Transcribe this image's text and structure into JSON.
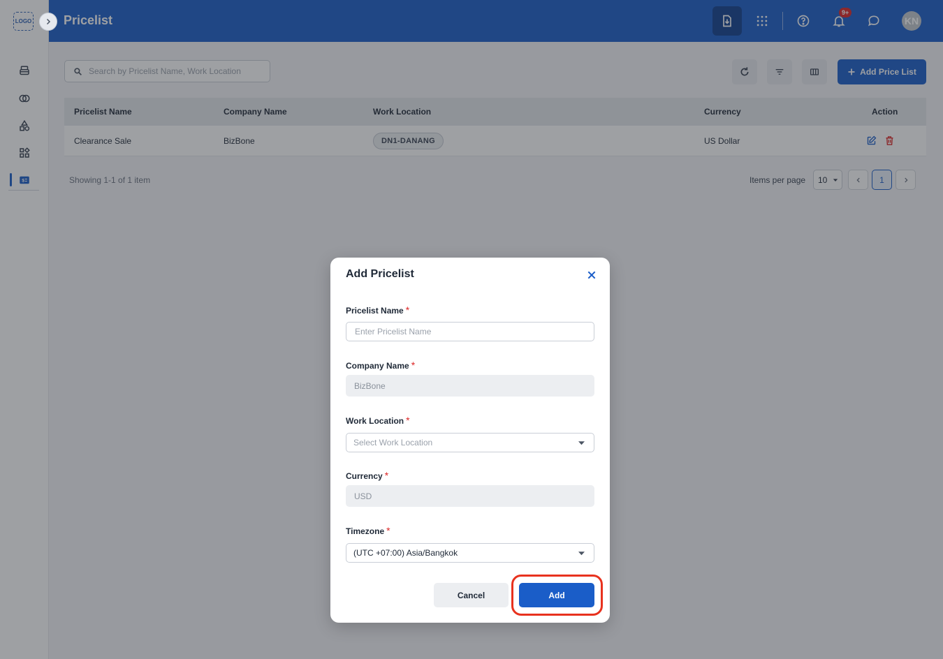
{
  "sidebar": {
    "logo": "LOGO",
    "items": [
      {
        "icon": "printer-icon"
      },
      {
        "icon": "overlap-circles-icon"
      },
      {
        "icon": "shapes-icon"
      },
      {
        "icon": "apps-icon"
      },
      {
        "icon": "pricelist-icon",
        "active": true
      }
    ]
  },
  "header": {
    "title": "Pricelist",
    "notification_badge": "9+",
    "avatar_initials": "KN"
  },
  "toolbar": {
    "search_placeholder": "Search by Pricelist Name, Work Location",
    "add_button_label": "Add Price List"
  },
  "table": {
    "columns": [
      "Pricelist Name",
      "Company Name",
      "Work Location",
      "Currency",
      "Action"
    ],
    "rows": [
      {
        "pricelist_name": "Clearance Sale",
        "company_name": "BizBone",
        "work_location": "DN1-DANANG",
        "currency": "US Dollar"
      }
    ]
  },
  "pagination": {
    "showing": "Showing 1-1 of 1 item",
    "items_per_page_label": "Items per page",
    "items_per_page": "10",
    "current_page": "1"
  },
  "modal": {
    "title": "Add Pricelist",
    "fields": {
      "pricelist_name": {
        "label": "Pricelist Name",
        "placeholder": "Enter Pricelist Name",
        "value": ""
      },
      "company_name": {
        "label": "Company Name",
        "value": "BizBone"
      },
      "work_location": {
        "label": "Work Location",
        "placeholder": "Select Work Location"
      },
      "currency": {
        "label": "Currency",
        "value": "USD"
      },
      "timezone": {
        "label": "Timezone",
        "value": "(UTC +07:00) Asia/Bangkok"
      }
    },
    "required_mark": "*",
    "cancel_label": "Cancel",
    "add_label": "Add"
  },
  "colors": {
    "primary": "#1a5dc8",
    "highlight": "#e8321e",
    "danger": "#dc2626"
  }
}
